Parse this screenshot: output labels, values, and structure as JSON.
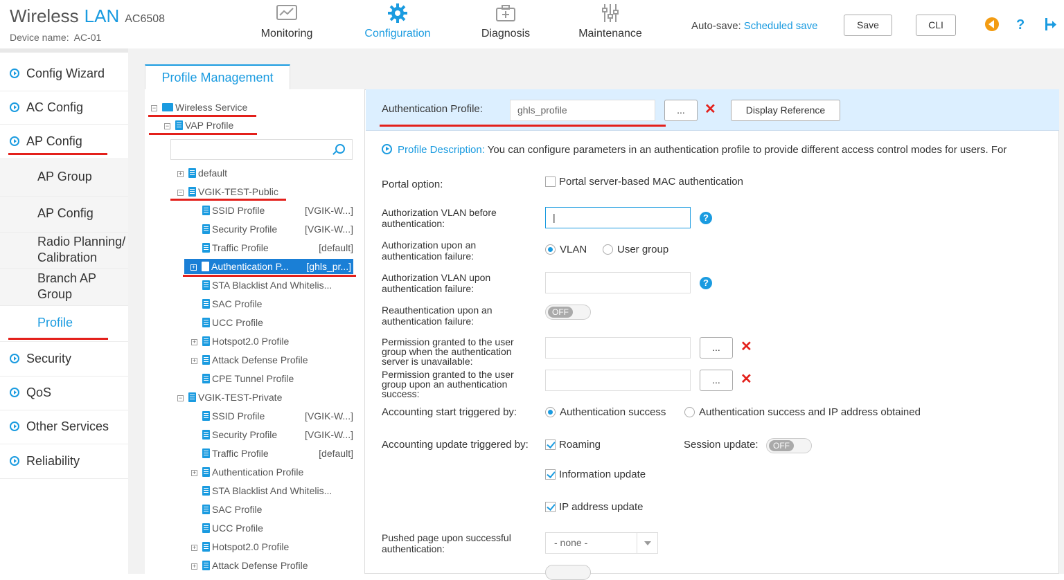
{
  "header": {
    "brand_main": "Wireless",
    "brand_lan": "LAN",
    "brand_model": "AC6508",
    "device_label": "Device name:",
    "device_name": "AC-01",
    "nav": [
      {
        "label": "Monitoring",
        "icon": "monitor-icon"
      },
      {
        "label": "Configuration",
        "icon": "gear-icon"
      },
      {
        "label": "Diagnosis",
        "icon": "toolbox-icon"
      },
      {
        "label": "Maintenance",
        "icon": "sliders-icon"
      }
    ],
    "autosave_label": "Auto-save:",
    "autosave_link": "Scheduled save",
    "save_label": "Save",
    "cli_label": "CLI",
    "accent": "#1a9be0"
  },
  "sidebar": {
    "items": [
      {
        "label": "Config Wizard"
      },
      {
        "label": "AC Config"
      },
      {
        "label": "AP Config"
      },
      {
        "label": "Security"
      },
      {
        "label": "QoS"
      },
      {
        "label": "Other Services"
      },
      {
        "label": "Reliability"
      }
    ],
    "subitems": [
      {
        "label": "AP Group"
      },
      {
        "label": "AP Config"
      },
      {
        "label": "Radio Planning/ Calibration"
      },
      {
        "label": "Branch AP Group"
      },
      {
        "label": "Profile"
      }
    ]
  },
  "tab": {
    "label": "Profile Management"
  },
  "tree": {
    "root": "Wireless Service",
    "vap": "VAP Profile",
    "search_placeholder": "",
    "nodes": [
      {
        "label": "default",
        "value": ""
      },
      {
        "label": "VGIK-TEST-Public",
        "value": ""
      },
      {
        "label": "SSID Profile",
        "value": "[VGIK-W...]"
      },
      {
        "label": "Security Profile",
        "value": "[VGIK-W...]"
      },
      {
        "label": "Traffic Profile",
        "value": "[default]"
      },
      {
        "label": "Authentication P...",
        "value": "[ghls_pr...]"
      },
      {
        "label": "STA Blacklist And Whitelis...",
        "value": ""
      },
      {
        "label": "SAC Profile",
        "value": ""
      },
      {
        "label": "UCC Profile",
        "value": ""
      },
      {
        "label": "Hotspot2.0 Profile",
        "value": ""
      },
      {
        "label": "Attack Defense Profile",
        "value": ""
      },
      {
        "label": "CPE Tunnel Profile",
        "value": ""
      },
      {
        "label": "VGIK-TEST-Private",
        "value": ""
      },
      {
        "label": "SSID Profile",
        "value": "[VGIK-W...]"
      },
      {
        "label": "Security Profile",
        "value": "[VGIK-W...]"
      },
      {
        "label": "Traffic Profile",
        "value": "[default]"
      },
      {
        "label": "Authentication Profile",
        "value": ""
      },
      {
        "label": "STA Blacklist And Whitelis...",
        "value": ""
      },
      {
        "label": "SAC Profile",
        "value": ""
      },
      {
        "label": "UCC Profile",
        "value": ""
      },
      {
        "label": "Hotspot2.0 Profile",
        "value": ""
      },
      {
        "label": "Attack Defense Profile",
        "value": ""
      }
    ]
  },
  "form": {
    "auth_profile_label": "Authentication Profile:",
    "auth_profile_value": "ghls_profile",
    "browse_label": "...",
    "display_reference_label": "Display Reference",
    "desc_key": "Profile Description:",
    "desc_text": " You can configure parameters in an authentication profile to provide different access control modes for users. For",
    "portal_option_label": "Portal option:",
    "portal_option_text": "Portal server-based MAC authentication",
    "auth_vlan_before_label": "Authorization VLAN before authentication:",
    "auth_vlan_before_value": "|",
    "auth_fail_label": "Authorization upon an authentication failure:",
    "auth_fail_opt1": "VLAN",
    "auth_fail_opt2": "User group",
    "auth_vlan_fail_label": "Authorization VLAN upon authentication failure:",
    "reauth_label": "Reauthentication upon an authentication failure:",
    "toggle_off": "OFF",
    "perm_unavail_label": "Permission granted to the user group when the authentication server is unavailable:",
    "perm_success_label": "Permission granted to the user group upon an authentication success:",
    "acct_start_label": "Accounting start triggered by:",
    "acct_start_opt1": "Authentication success",
    "acct_start_opt2": "Authentication success and IP address obtained",
    "acct_update_label": "Accounting update triggered by:",
    "acct_update_roaming": "Roaming",
    "session_update_label": "Session update:",
    "acct_update_info": "Information update",
    "acct_update_ip": "IP address update",
    "pushed_page_label": "Pushed page upon successful authentication:",
    "pushed_page_value": "- none -"
  }
}
